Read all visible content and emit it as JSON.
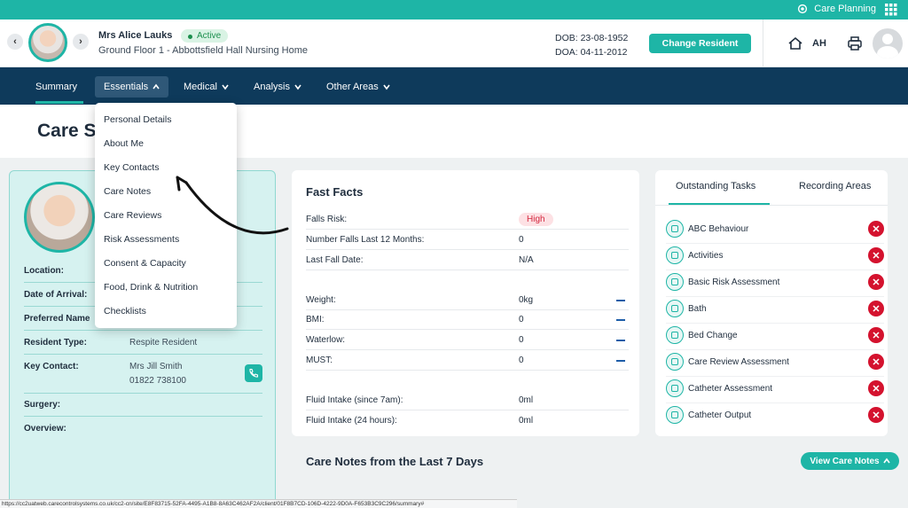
{
  "topbar": {
    "app_label": "Care Planning"
  },
  "resident": {
    "name": "Mrs Alice Lauks",
    "status": "Active",
    "location": "Ground Floor 1 - Abbottsfield Hall Nursing Home",
    "dob": "DOB: 23-08-1952",
    "doa": "DOA: 04-11-2012",
    "change_label": "Change Resident",
    "user_initials": "AH"
  },
  "nav": {
    "items": [
      {
        "label": "Summary"
      },
      {
        "label": "Essentials"
      },
      {
        "label": "Medical"
      },
      {
        "label": "Analysis"
      },
      {
        "label": "Other Areas"
      }
    ]
  },
  "page": {
    "title": "Care S"
  },
  "dropdown": {
    "items": [
      "Personal Details",
      "About Me",
      "Key Contacts",
      "Care Notes",
      "Care Reviews",
      "Risk Assessments",
      "Consent & Capacity",
      "Food, Drink & Nutrition",
      "Checklists"
    ]
  },
  "rescard": {
    "fields": [
      {
        "label": "Location:",
        "value": ""
      },
      {
        "label": "Date of Arrival:",
        "value": ""
      },
      {
        "label": "Preferred Name",
        "value": ""
      },
      {
        "label": "Resident Type:",
        "value": "Respite Resident"
      },
      {
        "label": "Key Contact:",
        "value": "Mrs Jill Smith",
        "value2": "01822 738100"
      },
      {
        "label": "Surgery:",
        "value": ""
      },
      {
        "label": "Overview:",
        "value": ""
      }
    ]
  },
  "facts": {
    "title": "Fast Facts",
    "falls_risk_label": "Falls Risk:",
    "falls_risk_value": "High",
    "rows": [
      {
        "label": "Number Falls Last 12 Months:",
        "value": "0"
      },
      {
        "label": "Last Fall Date:",
        "value": "N/A"
      },
      {
        "label": "Weight:",
        "value": "0kg"
      },
      {
        "label": "BMI:",
        "value": "0"
      },
      {
        "label": "Waterlow:",
        "value": "0"
      },
      {
        "label": "MUST:",
        "value": "0"
      },
      {
        "label": "Fluid Intake (since 7am):",
        "value": "0ml"
      },
      {
        "label": "Fluid Intake (24 hours):",
        "value": "0ml"
      }
    ]
  },
  "tasks": {
    "tab_outstanding": "Outstanding Tasks",
    "tab_recording": "Recording Areas",
    "items": [
      "ABC Behaviour",
      "Activities",
      "Basic Risk Assessment",
      "Bath",
      "Bed Change",
      "Care Review Assessment",
      "Catheter Assessment",
      "Catheter Output"
    ]
  },
  "care_notes": {
    "title": "Care Notes from the Last 7 Days",
    "view_label": "View Care Notes"
  },
  "statusbar": {
    "url": "https://cc2uatweb.carecontrolsystems.co.uk/cc2-cn/site/E8F83715-52FA-4495-A1B8-8A63C462AF2A/client/01F8B7CD-106D-4222-9D0A-F653B3C9C296/summary#"
  },
  "colors": {
    "accent": "#1eb5a6",
    "nav": "#0e3a5b",
    "danger": "#d4122e"
  }
}
